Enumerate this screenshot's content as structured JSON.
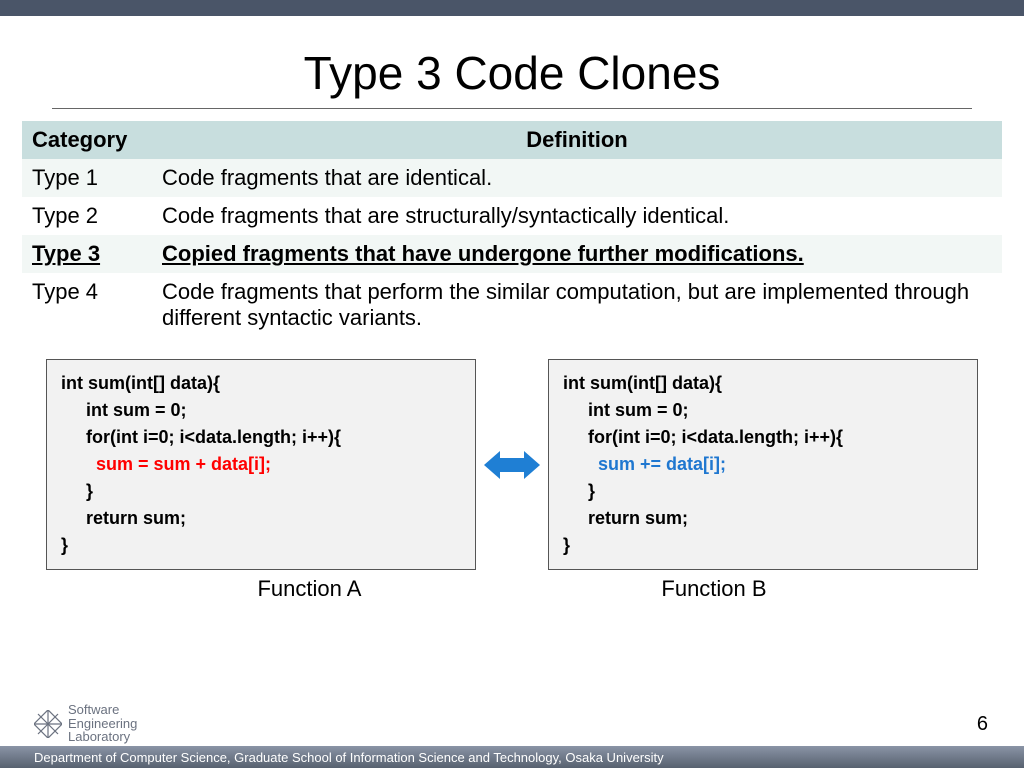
{
  "title": "Type 3 Code Clones",
  "table": {
    "headers": {
      "category": "Category",
      "definition": "Definition"
    },
    "rows": [
      {
        "category": "Type 1",
        "definition": "Code fragments that are identical.",
        "emphasis": false
      },
      {
        "category": "Type 2",
        "definition": "Code fragments that are structurally/syntactically identical.",
        "emphasis": false
      },
      {
        "category": "Type 3",
        "definition": "Copied fragments that have undergone further modifications.",
        "emphasis": true
      },
      {
        "category": "Type 4",
        "definition": "Code fragments that perform the similar computation, but are implemented through different syntactic variants.",
        "emphasis": false
      }
    ]
  },
  "code": {
    "a": {
      "l1": "int sum(int[] data){",
      "l2": "     int sum = 0;",
      "l3": "     for(int i=0; i<data.length; i++){",
      "l4": "       sum = sum + data[i];",
      "l5": "     }",
      "l6": "     return sum;",
      "l7": "}"
    },
    "b": {
      "l1": "int sum(int[] data){",
      "l2": "     int sum = 0;",
      "l3": "     for(int i=0; i<data.length; i++){",
      "l4": "       sum += data[i];",
      "l5": "     }",
      "l6": "     return sum;",
      "l7": "}"
    },
    "labelA": "Function A",
    "labelB": "Function B"
  },
  "logo": {
    "line1": "Software",
    "line2": "Engineering",
    "line3": "Laboratory"
  },
  "footer_text": "Department of Computer Science, Graduate School of Information Science and Technology, Osaka University",
  "page_number": "6"
}
